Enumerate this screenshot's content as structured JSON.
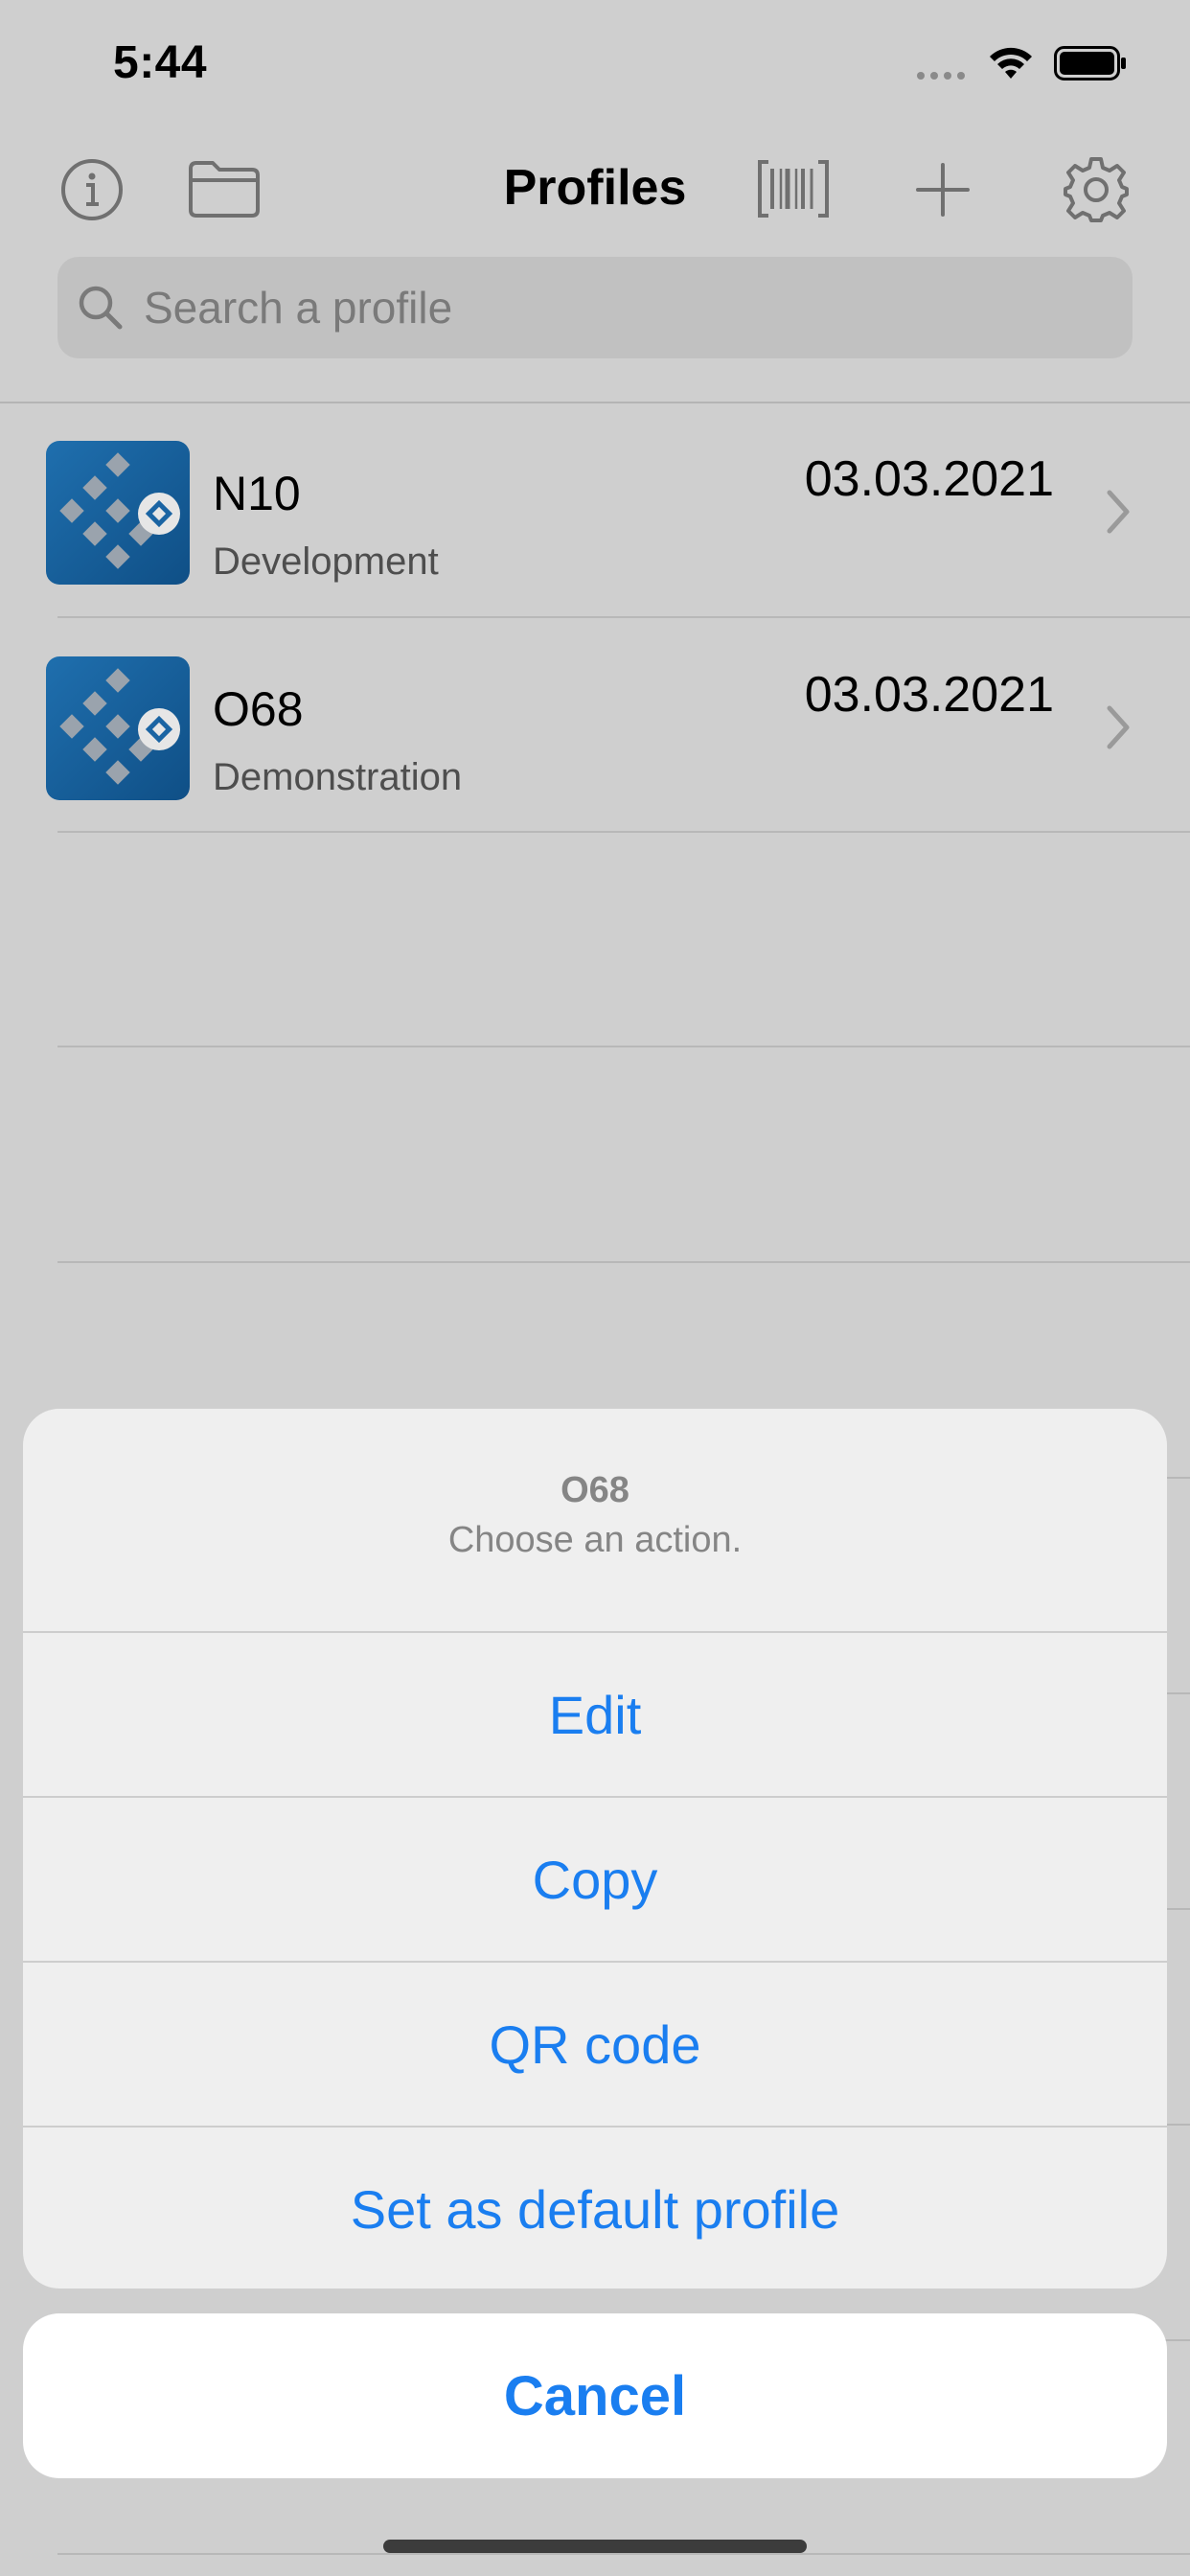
{
  "status_bar": {
    "time": "5:44"
  },
  "nav": {
    "title": "Profiles",
    "icons": [
      "info-icon",
      "folder-icon",
      "barcode-scan-icon",
      "plus-icon",
      "gear-icon"
    ]
  },
  "search": {
    "placeholder": "Search a profile"
  },
  "profiles": [
    {
      "name": "N10",
      "subtitle": "Development",
      "date": "03.03.2021"
    },
    {
      "name": "O68",
      "subtitle": "Demonstration",
      "date": "03.03.2021"
    }
  ],
  "action_sheet": {
    "title": "O68",
    "message": "Choose an action.",
    "actions": [
      "Edit",
      "Copy",
      "QR code",
      "Set as default profile"
    ],
    "cancel": "Cancel"
  },
  "colors": {
    "accent": "#1a7ef0",
    "dim_background": "#cfcfcf",
    "logo_blue": "#1a64a3"
  }
}
